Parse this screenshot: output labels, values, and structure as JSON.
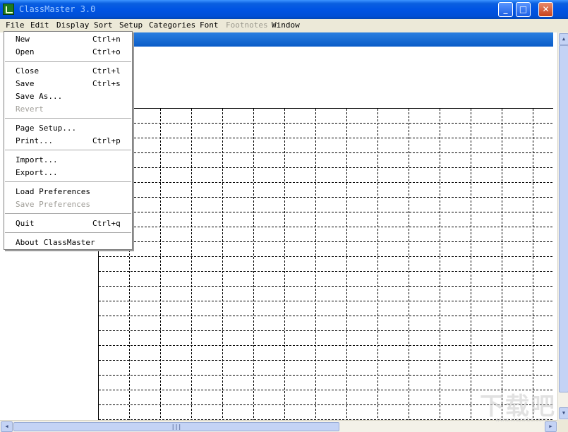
{
  "window": {
    "title": "ClassMaster 3.0",
    "minimize_glyph": "_",
    "maximize_glyph": "□",
    "close_glyph": "✕"
  },
  "menubar": {
    "items": [
      {
        "label": "File",
        "disabled": false,
        "active": true
      },
      {
        "label": "Edit",
        "disabled": false
      },
      {
        "label": "Display",
        "disabled": false
      },
      {
        "label": "Sort",
        "disabled": false
      },
      {
        "label": "Setup",
        "disabled": false
      },
      {
        "label": "Categories",
        "disabled": false
      },
      {
        "label": "Font",
        "disabled": false
      },
      {
        "label": "Footnotes",
        "disabled": true
      },
      {
        "label": "Window",
        "disabled": false
      }
    ]
  },
  "file_menu": {
    "items": [
      {
        "label": "New",
        "shortcut": "Ctrl+n",
        "disabled": false
      },
      {
        "label": "Open",
        "shortcut": "Ctrl+o",
        "disabled": false
      },
      {
        "label": "Close",
        "shortcut": "Ctrl+l",
        "disabled": false
      },
      {
        "label": "Save",
        "shortcut": "Ctrl+s",
        "disabled": false
      },
      {
        "label": "Save As...",
        "shortcut": "",
        "disabled": false
      },
      {
        "label": "Revert",
        "shortcut": "",
        "disabled": true
      },
      {
        "label": "Page Setup...",
        "shortcut": "",
        "disabled": false
      },
      {
        "label": "Print...",
        "shortcut": "Ctrl+p",
        "disabled": false
      },
      {
        "label": "Import...",
        "shortcut": "",
        "disabled": false
      },
      {
        "label": "Export...",
        "shortcut": "",
        "disabled": false
      },
      {
        "label": "Load Preferences",
        "shortcut": "",
        "disabled": false
      },
      {
        "label": "Save Preferences",
        "shortcut": "",
        "disabled": true
      },
      {
        "label": "Quit",
        "shortcut": "Ctrl+q",
        "disabled": false
      },
      {
        "label": "About ClassMaster",
        "shortcut": "",
        "disabled": false
      }
    ]
  },
  "hscroll": {
    "grip": "|||"
  },
  "watermark": {
    "text": "下载吧",
    "site": "www.xiazaiba.com"
  },
  "colors": {
    "titlebar": "#0054e3",
    "doc_titlebar": "#0a5cc8",
    "menubar_bg": "#ece9d8",
    "disabled_text": "#9c9a8f"
  }
}
